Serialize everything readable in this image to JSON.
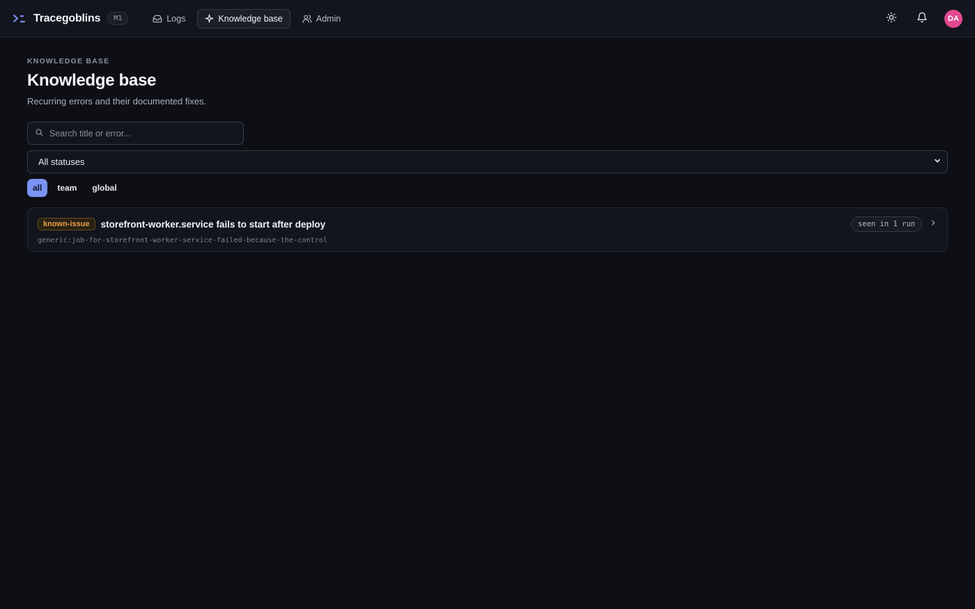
{
  "app": {
    "name": "Tracegoblins",
    "badge": "M1",
    "logo_icon": "terminal-prompt-icon",
    "accent": "#7b93f2"
  },
  "nav": {
    "items": [
      {
        "label": "Logs",
        "icon": "inbox-icon",
        "active": false
      },
      {
        "label": "Knowledge base",
        "icon": "sparkle-icon",
        "active": true
      },
      {
        "label": "Admin",
        "icon": "users-icon",
        "active": false
      }
    ]
  },
  "header_actions": {
    "theme_icon": "sun-icon",
    "notifications_icon": "bell-icon",
    "avatar_initials": "DA",
    "avatar_color": "#e2478f"
  },
  "page": {
    "eyebrow": "KNOWLEDGE BASE",
    "title": "Knowledge base",
    "subtitle": "Recurring errors and their documented fixes."
  },
  "search": {
    "placeholder": "Search title or error...",
    "value": ""
  },
  "filters": {
    "status_selected": "All statuses",
    "scope_tabs": [
      {
        "label": "all",
        "active": true
      },
      {
        "label": "team",
        "active": false
      },
      {
        "label": "global",
        "active": false
      }
    ]
  },
  "entries": [
    {
      "tag": "known-issue",
      "title": "storefront-worker.service fails to start after deploy",
      "signature": "generic:job-for-storefront-worker-service-failed-because-the-control",
      "seen": "seen in 1 run"
    }
  ]
}
